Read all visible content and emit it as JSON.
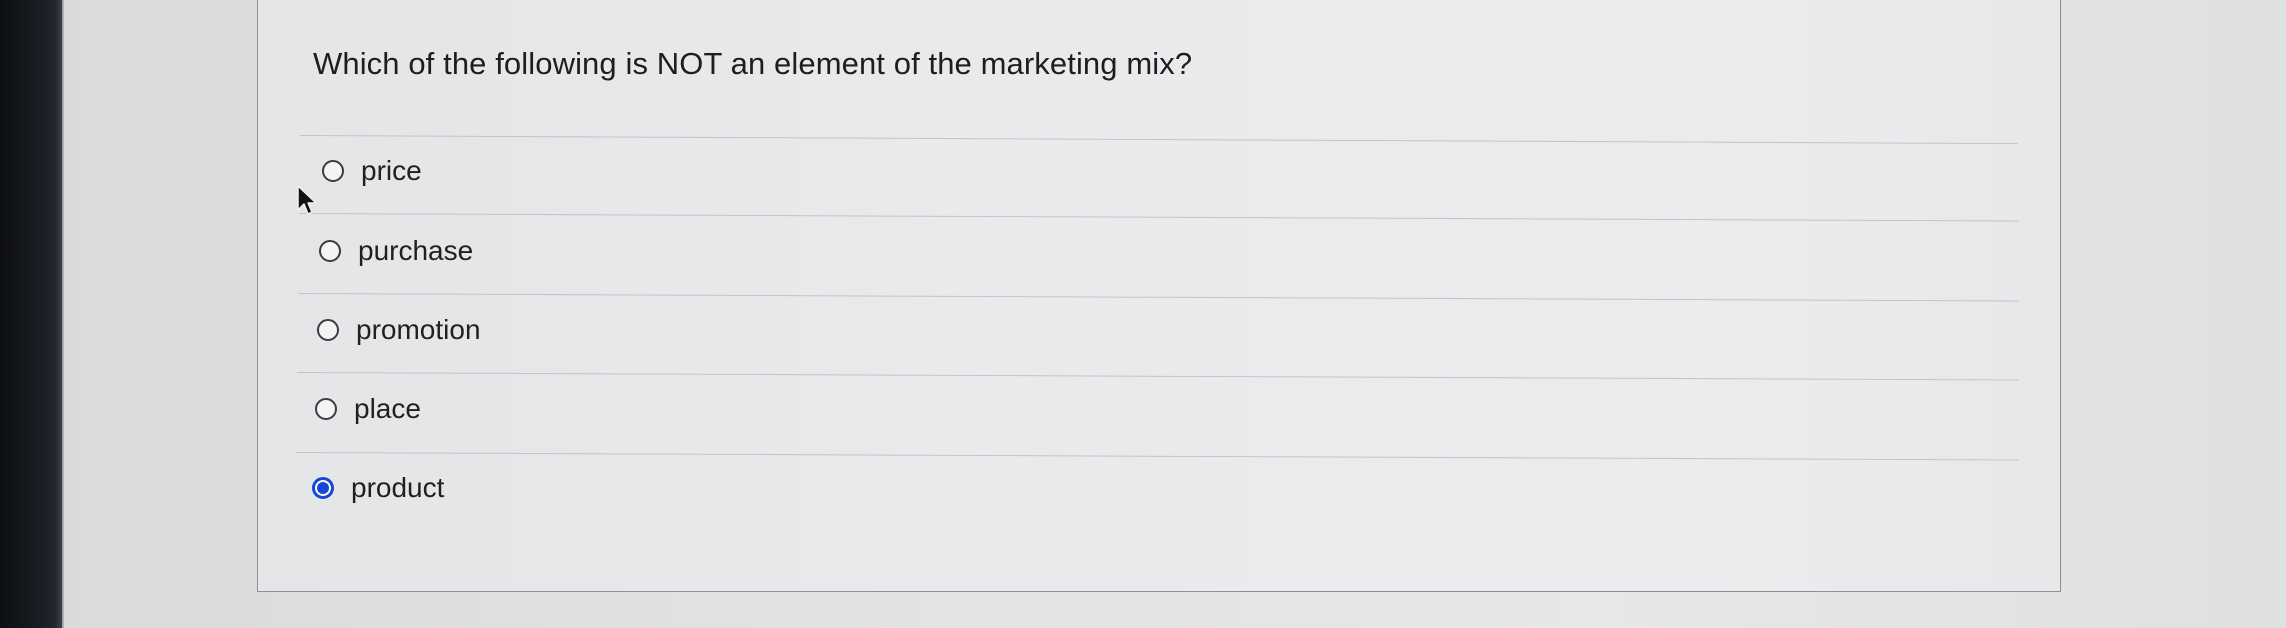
{
  "question": {
    "text": "Which of the following is NOT an element of the marketing mix?"
  },
  "options": [
    {
      "label": "price",
      "selected": false
    },
    {
      "label": "purchase",
      "selected": false
    },
    {
      "label": "promotion",
      "selected": false
    },
    {
      "label": "place",
      "selected": false
    },
    {
      "label": "product",
      "selected": true
    }
  ],
  "colors": {
    "accent": "#1747d6",
    "text": "#1f2022",
    "divider": "#c2c4c7"
  },
  "icons": {
    "cursor": "mouse-pointer-icon"
  }
}
